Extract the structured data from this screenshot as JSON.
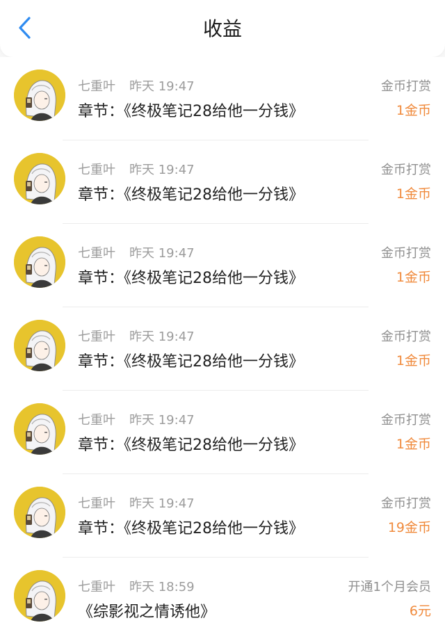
{
  "header": {
    "title": "收益"
  },
  "colors": {
    "accent": "#2f8bf0",
    "amount": "#f08a3c",
    "avatar_bg": "#e7c42d"
  },
  "records": [
    {
      "user": "七重叶",
      "time": "昨天 19:47",
      "content": "章节：《终极笔记28给他一分钱》",
      "type": "金币打赏",
      "amount": "1金币"
    },
    {
      "user": "七重叶",
      "time": "昨天 19:47",
      "content": "章节：《终极笔记28给他一分钱》",
      "type": "金币打赏",
      "amount": "1金币"
    },
    {
      "user": "七重叶",
      "time": "昨天 19:47",
      "content": "章节：《终极笔记28给他一分钱》",
      "type": "金币打赏",
      "amount": "1金币"
    },
    {
      "user": "七重叶",
      "time": "昨天 19:47",
      "content": "章节：《终极笔记28给他一分钱》",
      "type": "金币打赏",
      "amount": "1金币"
    },
    {
      "user": "七重叶",
      "time": "昨天 19:47",
      "content": "章节：《终极笔记28给他一分钱》",
      "type": "金币打赏",
      "amount": "1金币"
    },
    {
      "user": "七重叶",
      "time": "昨天 19:47",
      "content": "章节：《终极笔记28给他一分钱》",
      "type": "金币打赏",
      "amount": "19金币"
    },
    {
      "user": "七重叶",
      "time": "昨天 18:59",
      "content": "《综影视之情诱他》",
      "type": "开通1个月会员",
      "amount": "6元"
    }
  ]
}
